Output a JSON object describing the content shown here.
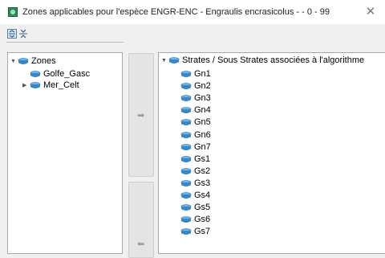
{
  "window": {
    "title": "Zones applicables pour l'espèce  ENGR-ENC - Engraulis encrasicolus -  - 0 - 99",
    "close_glyph": "✕"
  },
  "toolbar": {
    "buttons": [
      {
        "name": "expand-all",
        "icon": "expand-all-icon"
      },
      {
        "name": "collapse-all",
        "icon": "collapse-all-icon"
      }
    ]
  },
  "left_tree": {
    "root": {
      "label": "Zones",
      "expanded": true
    },
    "items": [
      {
        "label": "Golfe_Gasc",
        "has_children": false
      },
      {
        "label": "Mer_Celt",
        "has_children": true,
        "expanded": false
      }
    ]
  },
  "transfer": {
    "add_glyph": "➡",
    "remove_glyph": "⬅"
  },
  "right_tree": {
    "root": {
      "label": "Strates / Sous Strates associées à l'algorithme",
      "expanded": true
    },
    "items": [
      "Gn1",
      "Gn2",
      "Gn3",
      "Gn4",
      "Gn5",
      "Gn6",
      "Gn7",
      "Gs1",
      "Gs2",
      "Gs3",
      "Gs4",
      "Gs5",
      "Gs6",
      "Gs7"
    ]
  },
  "colors": {
    "db_icon_top": "#6fb6e6",
    "db_icon_side": "#3a85c4",
    "tree_arrow": "#555555"
  }
}
